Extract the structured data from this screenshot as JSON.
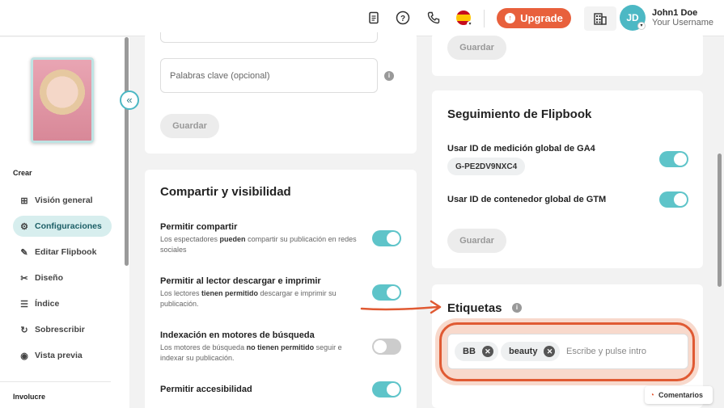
{
  "header": {
    "upgrade_label": "Upgrade",
    "user_name": "John1 Doe",
    "user_sub": "Your Username",
    "avatar_initials": "JD"
  },
  "sidebar": {
    "section_create": "Crear",
    "section_involve": "Involucre",
    "items": [
      {
        "label": "Visión general",
        "icon": "grid-icon"
      },
      {
        "label": "Configuraciones",
        "icon": "gear-icon",
        "active": true
      },
      {
        "label": "Editar Flipbook",
        "icon": "pencil-icon"
      },
      {
        "label": "Diseño",
        "icon": "tools-icon"
      },
      {
        "label": "Índice",
        "icon": "list-icon"
      },
      {
        "label": "Sobrescribir",
        "icon": "refresh-icon"
      },
      {
        "label": "Vista previa",
        "icon": "eye-icon"
      }
    ]
  },
  "seo": {
    "keywords_placeholder": "Palabras clave (opcional)",
    "save_label": "Guardar"
  },
  "sharing": {
    "title": "Compartir y visibilidad",
    "options": [
      {
        "title": "Permitir compartir",
        "desc_pre": "Los espectadores ",
        "desc_bold": "pueden",
        "desc_post": " compartir su publicación en redes sociales",
        "enabled": true
      },
      {
        "title": "Permitir al lector descargar e imprimir",
        "desc_pre": "Los lectores ",
        "desc_bold": "tienen permitido",
        "desc_post": " descargar e imprimir su publicación.",
        "enabled": true
      },
      {
        "title": "Indexación en motores de búsqueda",
        "desc_pre": "Los motores de búsqueda ",
        "desc_bold": "no tienen permitido",
        "desc_post": " seguir e indexar su publicación.",
        "enabled": false
      },
      {
        "title": "Permitir accesibilidad",
        "desc_pre": "",
        "desc_bold": "",
        "desc_post": "",
        "enabled": true
      }
    ]
  },
  "top_right": {
    "save_label": "Guardar"
  },
  "tracking": {
    "title": "Seguimiento de Flipbook",
    "ga4_label": "Usar ID de medición global de GA4",
    "ga4_value": "G-PE2DV9NXC4",
    "ga4_enabled": true,
    "gtm_label": "Usar ID de contenedor global de GTM",
    "gtm_enabled": true,
    "save_label": "Guardar"
  },
  "tags": {
    "title": "Etiquetas",
    "items": [
      "BB",
      "beauty"
    ],
    "input_placeholder": "Escribe y pulse intro"
  },
  "comments_label": "Comentarios",
  "colors": {
    "accent": "#4cb8c4",
    "toggle_on": "#5ec4c9",
    "upgrade": "#e8603c",
    "annotation": "#e05a33"
  }
}
